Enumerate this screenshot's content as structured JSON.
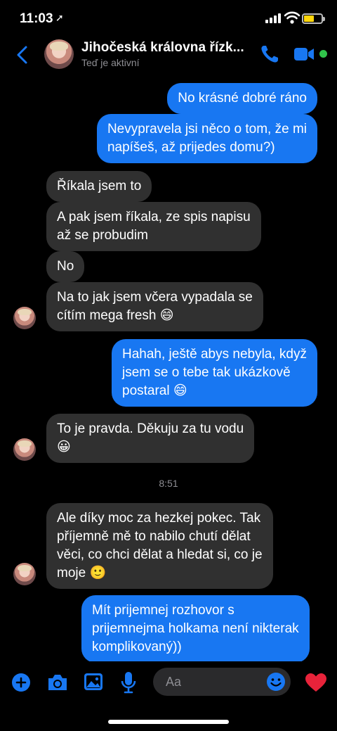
{
  "status_bar": {
    "time": "11:03",
    "battery_level": 0.6
  },
  "header": {
    "contact_name": "Jihočeská královna řízk...",
    "status": "Teď je aktivní",
    "accent_color": "#1877f2",
    "online_color": "#31c44b"
  },
  "messages": [
    {
      "from": "me",
      "text": "No krásné dobré ráno"
    },
    {
      "from": "me",
      "text": "Nevypravela jsi něco o tom, že mi\nnapíšeš, až prijedes domu?)"
    },
    {
      "from": "them",
      "text": "Říkala jsem to"
    },
    {
      "from": "them",
      "text": "A pak jsem říkala, ze spis napisu\naž se probudim"
    },
    {
      "from": "them",
      "text": "No"
    },
    {
      "from": "them",
      "text": "Na to jak jsem včera vypadala se\ncítím mega fresh 😄"
    },
    {
      "from": "me",
      "text": "Hahah, ještě abys nebyla, když\njsem se o tebe tak ukázkově\npostaral 😄"
    },
    {
      "from": "them",
      "text": "To je pravda. Děkuju za tu vodu\n😀"
    },
    {
      "from": "them",
      "text": "Ale díky moc za hezkej pokec. Tak\npříjemně mě to nabilo chutí dělat\nvěci, co chci dělat a hledat si, co je\nmoje 🙂"
    },
    {
      "from": "me",
      "text": "Mít prijemnej rozhovor s\nprijemnejma holkama není nikterak\nkomplikovaný))"
    }
  ],
  "timestamp": "8:51",
  "composer": {
    "placeholder": "Aa",
    "icons": [
      "plus-icon",
      "camera-icon",
      "gallery-icon",
      "microphone-icon",
      "emoji-icon",
      "heart-icon"
    ]
  }
}
